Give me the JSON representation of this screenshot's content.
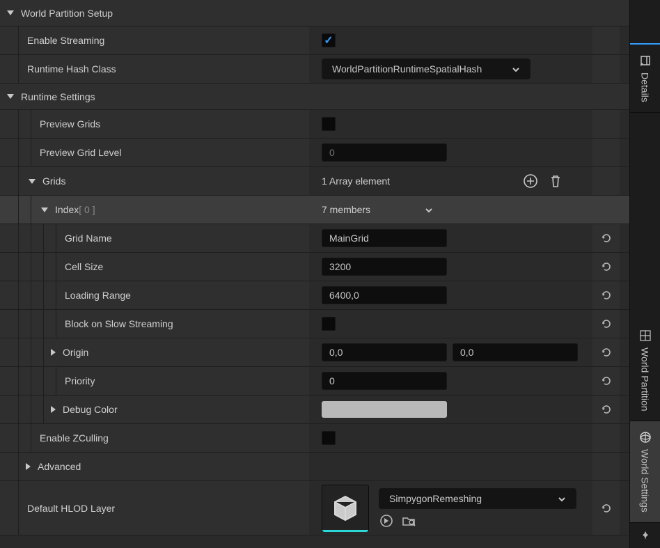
{
  "sections": {
    "world_partition_setup": "World Partition Setup",
    "runtime_settings": "Runtime Settings"
  },
  "rows": {
    "enable_streaming": {
      "label": "Enable Streaming",
      "checked": true
    },
    "runtime_hash_class": {
      "label": "Runtime Hash Class",
      "value": "WorldPartitionRuntimeSpatialHash"
    },
    "preview_grids": {
      "label": "Preview Grids",
      "checked": false
    },
    "preview_grid_level": {
      "label": "Preview Grid Level",
      "placeholder": "0"
    },
    "grids": {
      "label": "Grids",
      "count_text": "1 Array element"
    },
    "index0": {
      "prefix": "Index",
      "bracket": " [ 0 ]",
      "members": "7 members"
    },
    "grid_name": {
      "label": "Grid Name",
      "value": "MainGrid"
    },
    "cell_size": {
      "label": "Cell Size",
      "value": "3200"
    },
    "loading_range": {
      "label": "Loading Range",
      "value": "6400,0"
    },
    "block_slow": {
      "label": "Block on Slow Streaming",
      "checked": false
    },
    "origin": {
      "label": "Origin",
      "x": "0,0",
      "y": "0,0"
    },
    "priority": {
      "label": "Priority",
      "value": "0"
    },
    "debug_color": {
      "label": "Debug Color",
      "color": "#b9b9b9"
    },
    "enable_zculling": {
      "label": "Enable ZCulling",
      "checked": false
    },
    "advanced": {
      "label": "Advanced"
    },
    "hlod": {
      "label": "Default HLOD Layer",
      "value": "SimpygonRemeshing"
    }
  },
  "side_tabs": {
    "details": "Details",
    "world_partition": "World Partition",
    "world_settings": "World Settings"
  }
}
